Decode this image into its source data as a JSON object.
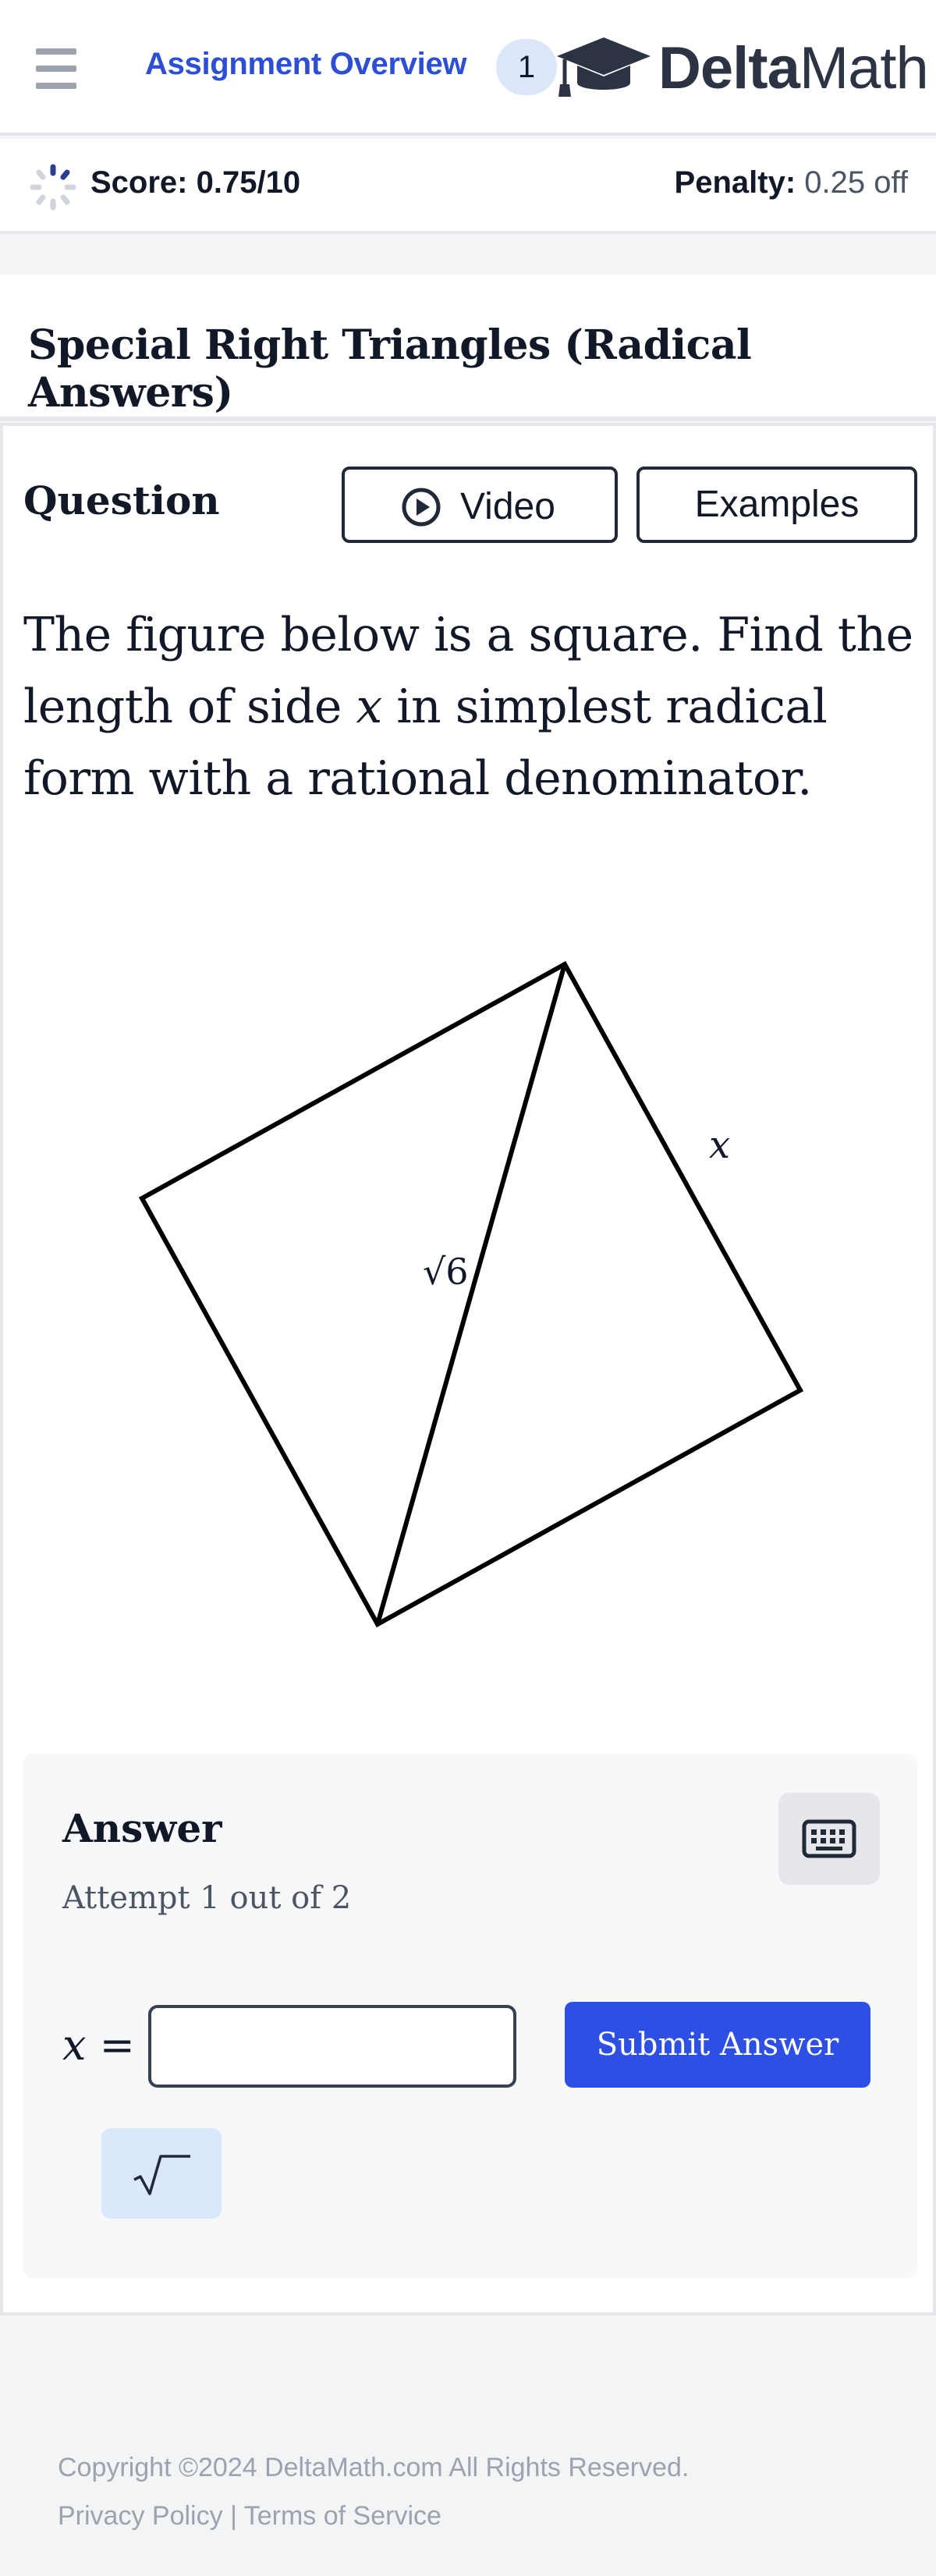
{
  "header": {
    "assignment_link": "Assignment Overview",
    "count_badge": "1",
    "logo_text_bold": "Delta",
    "logo_text_light": "Math"
  },
  "scorebar": {
    "score": "Score: 0.75/10",
    "penalty_label": "Penalty:",
    "penalty_value": "0.25 off"
  },
  "title": "Special Right Triangles (Radical Answers)",
  "question": {
    "heading": "Question",
    "video_label": "Video",
    "examples_label": "Examples",
    "prompt_part1": "The figure below is a square. Find the length of side ",
    "prompt_var": "x",
    "prompt_part2": " in simplest radical form with a rational denominator.",
    "figure_diagonal_label": "√6",
    "figure_side_label": "x"
  },
  "answer": {
    "heading": "Answer",
    "attempt": "Attempt 1 out of 2",
    "var_label": "x",
    "equals": "=",
    "input_value": "",
    "submit_label": "Submit Answer"
  },
  "footer": {
    "copyright": "Copyright ©2024 DeltaMath.com All Rights Reserved.",
    "privacy": "Privacy Policy",
    "separator": "|",
    "terms": "Terms of Service"
  },
  "colors": {
    "link_blue": "#2d4fd6",
    "submit_blue": "#2d4fe3",
    "badge_bg": "#dbe7f8",
    "sqrt_bg": "#dbe7fb"
  },
  "icons": {
    "menu": "hamburger-icon",
    "logo": "graduation-cap-icon",
    "score": "progress-ring-icon",
    "video": "play-circle-icon",
    "keyboard": "keyboard-icon",
    "sqrt": "square-root-icon"
  }
}
